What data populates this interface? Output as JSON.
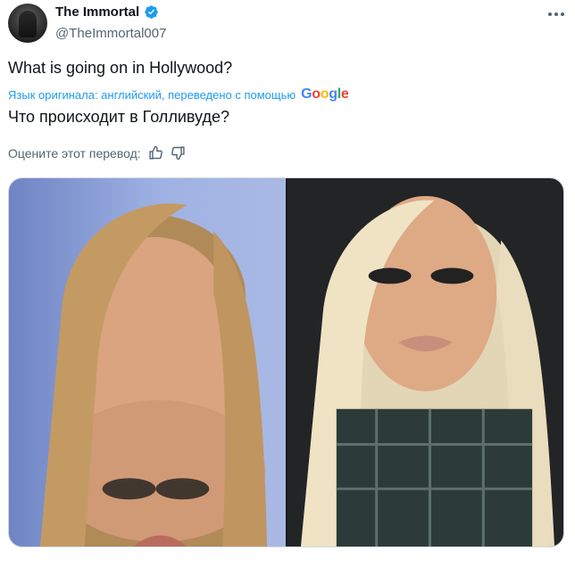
{
  "author": {
    "display_name": "The Immortal",
    "handle": "@TheImmortal007",
    "verified_icon": "verified-badge-icon",
    "avatar_icon": "hooded-figure-avatar"
  },
  "tweet": {
    "text": "What is going on in Hollywood?",
    "translation_note": "Язык оригинала: английский, переведено с помощью",
    "translation_provider": "Google",
    "translated_text": "Что происходит в Голливуде?",
    "rate_translation_label": "Оцените этот перевод:"
  },
  "colors": {
    "accent": "#1d9bf0",
    "secondary_text": "#536471",
    "primary_text": "#0f1419"
  }
}
